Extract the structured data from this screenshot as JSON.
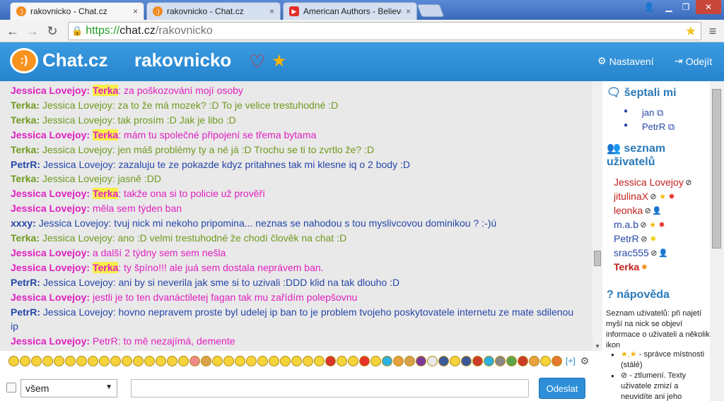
{
  "browser": {
    "tabs": [
      {
        "label": "rakovnicko - Chat.cz",
        "close": "×"
      },
      {
        "label": "rakovnicko - Chat.cz",
        "close": "×"
      },
      {
        "label": "American Authors - Believer",
        "close": "×"
      }
    ],
    "url": {
      "scheme": "https://",
      "host": "chat.cz",
      "path": "/rakovnicko"
    }
  },
  "header": {
    "logo_text": "Chat.cz",
    "room": "rakovnicko",
    "settings": "Nastavení",
    "logout": "Odejít"
  },
  "messages": [
    {
      "nick": "Jessica Lovejoy:",
      "nick_color": "jes",
      "highlight": "Terka",
      "text": ": za poškozování mojí osoby"
    },
    {
      "nick": "Terka:",
      "nick_color": "ter",
      "highlight": "",
      "text": " Jessica Lovejoy: za to že má mozek? :D To je velice trestuhodné :D"
    },
    {
      "nick": "Terka:",
      "nick_color": "ter",
      "highlight": "",
      "text": " Jessica Lovejoy: tak prosím :D Jak je libo :D"
    },
    {
      "nick": "Jessica Lovejoy:",
      "nick_color": "jes",
      "highlight": "Terka",
      "text": ": mám tu společné připojení se třema bytama"
    },
    {
      "nick": "Terka:",
      "nick_color": "ter",
      "highlight": "",
      "text": " Jessica Lovejoy: jen máš problémy ty a né já :D Trochu se ti to zvrtlo že? :D"
    },
    {
      "nick": "PetrR:",
      "nick_color": "pet",
      "highlight": "",
      "text": " Jessica Lovejoy: zazaluju te ze pokazde kdyz pritahnes tak mi klesne iq o 2 body :D"
    },
    {
      "nick": "Terka:",
      "nick_color": "ter",
      "highlight": "",
      "text": " Jessica Lovejoy: jasně :DD"
    },
    {
      "nick": "Jessica Lovejoy:",
      "nick_color": "jes",
      "highlight": "Terka",
      "text": ": takže ona si to policie už prověří"
    },
    {
      "nick": "Jessica Lovejoy:",
      "nick_color": "jes",
      "highlight": "",
      "text": " měla sem týden ban"
    },
    {
      "nick": "xxxy:",
      "nick_color": "xx",
      "highlight": "",
      "text": " Jessica Lovejoy: tvuj nick mi nekoho pripomina... neznas se nahodou s tou myslivcovou dominikou ? :-)ú"
    },
    {
      "nick": "Terka:",
      "nick_color": "ter",
      "highlight": "",
      "text": " Jessica Lovejoy: ano :D velmi trestuhodné že chodí člověk na chat :D"
    },
    {
      "nick": "Jessica Lovejoy:",
      "nick_color": "jes",
      "highlight": "",
      "text": " a další 2 týdny sem sem nešla"
    },
    {
      "nick": "Jessica Lovejoy:",
      "nick_color": "jes",
      "highlight": "Terka",
      "text": ": ty špíno!!! ale juá sem dostala neprávem ban."
    },
    {
      "nick": "PetrR:",
      "nick_color": "pet",
      "highlight": "",
      "text": " Jessica Lovejoy: ani by si neverila jak sme si to uzivali :DDD klid na tak dlouho :D"
    },
    {
      "nick": "Jessica Lovejoy:",
      "nick_color": "jes",
      "highlight": "",
      "text": " jestli je to ten dvanáctiletej fagan tak mu zařídím polepšovnu"
    },
    {
      "nick": "PetrR:",
      "nick_color": "pet",
      "highlight": "",
      "text": " Jessica Lovejoy: hovno nepravem proste byl udelej ip ban to je problem tvojeho poskytovatele internetu ze mate sdilenou"
    },
    {
      "nick": "",
      "nick_color": "pet",
      "highlight": "",
      "text": "ip"
    },
    {
      "nick": "Jessica Lovejoy:",
      "nick_color": "jes",
      "highlight": "",
      "text": " PetrR: to mě nezajímá, demente"
    }
  ],
  "sidebar": {
    "whispered_title": "šeptali mi",
    "whispered": [
      "jan",
      "PetrR"
    ],
    "users_title": "seznam uživatelů",
    "users": [
      {
        "name": "Jessica Lovejoy",
        "color": "#c0201c",
        "icons": [
          "ban"
        ]
      },
      {
        "name": "jitulinaX",
        "color": "#c0201c",
        "icons": [
          "ban",
          "star",
          "sun-red"
        ]
      },
      {
        "name": "leonka",
        "color": "#c0201c",
        "icons": [
          "ban",
          "person"
        ]
      },
      {
        "name": "m.a.b",
        "color": "#2646a8",
        "icons": [
          "ban",
          "star",
          "sun-red"
        ]
      },
      {
        "name": "PetrR",
        "color": "#2646a8",
        "icons": [
          "ban",
          "sun-yellow"
        ]
      },
      {
        "name": "srac555",
        "color": "#2646a8",
        "icons": [
          "ban",
          "person"
        ]
      },
      {
        "name": "Terka",
        "color": "#c0201c",
        "bold": true,
        "icons": [
          "sun-orange"
        ]
      }
    ],
    "help_title": "nápověda",
    "help_text": "Seznam uživatelů: při najetí myší na nick se objeví informace o uživateli a několik ikon",
    "help_items": [
      "- správce místnosti (stálé)",
      "- ztlumení. Texty uživatele zmizí a neuvidíte ani jeho šeptání."
    ]
  },
  "composer": {
    "target": "všem",
    "more_emoji": "[+]",
    "send": "Odeslat"
  },
  "colors": {
    "accent": "#2d8fd8",
    "orange": "#f7931e"
  }
}
